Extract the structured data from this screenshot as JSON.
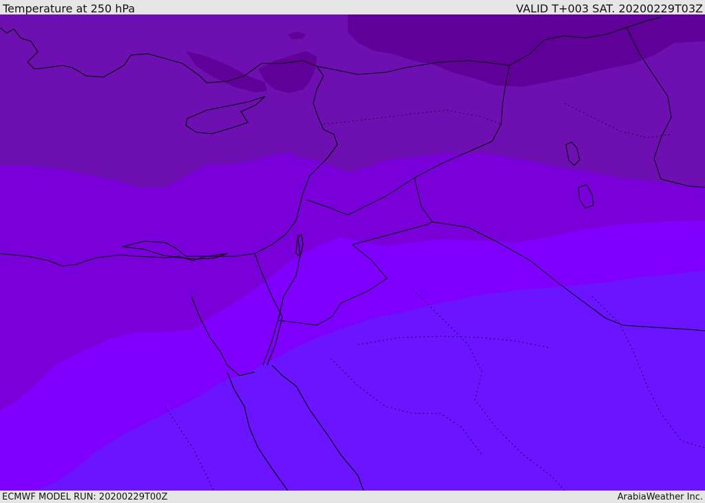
{
  "header": {
    "title": "Temperature at 250 hPa",
    "valid": "VALID T+003 SAT. 20200229T03Z"
  },
  "footer": {
    "model_run": "ECMWF MODEL RUN: 20200229T00Z",
    "credit": "ArabiaWeather Inc."
  },
  "map": {
    "field": "temperature",
    "level": "250 hPa",
    "colors": {
      "coldest": "#5f0098",
      "colder": "#6d0fb1",
      "cold": "#7a00d9",
      "mild": "#8000ff",
      "warm": "#6a14ff",
      "border": "#000000"
    }
  }
}
